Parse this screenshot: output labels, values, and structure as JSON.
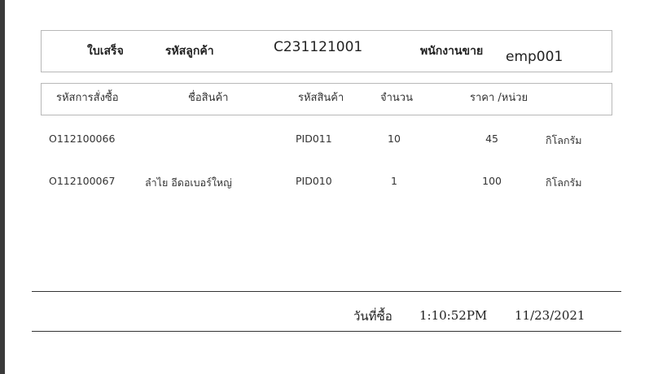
{
  "receipt": {
    "title": "ใบเสร็จ",
    "customer_label": "รหัสลูกค้า",
    "customer_id": "C231121001",
    "salesperson_label": "พนักงานขาย",
    "salesperson_id": "emp001"
  },
  "columns": {
    "order_id": "รหัสการสั่งซื้อ",
    "product_name": "ชื่อสินค้า",
    "product_id": "รหัสสินค้า",
    "quantity": "จำนวน",
    "price_per_unit": "ราคา /หน่วย"
  },
  "rows": [
    {
      "order_id": "O112100066",
      "product_name": "",
      "product_id": "PID011",
      "quantity": "10",
      "price": "45",
      "unit": "กิโลกรัม"
    },
    {
      "order_id": "O112100067",
      "product_name": "ลำไย อีดอเบอร์ใหญ่",
      "product_id": "PID010",
      "quantity": "1",
      "price": "100",
      "unit": "กิโลกรัม"
    }
  ],
  "footer": {
    "purchase_date_label": "วันที่ซื้อ",
    "time": "1:10:52PM",
    "date": "11/23/2021"
  }
}
